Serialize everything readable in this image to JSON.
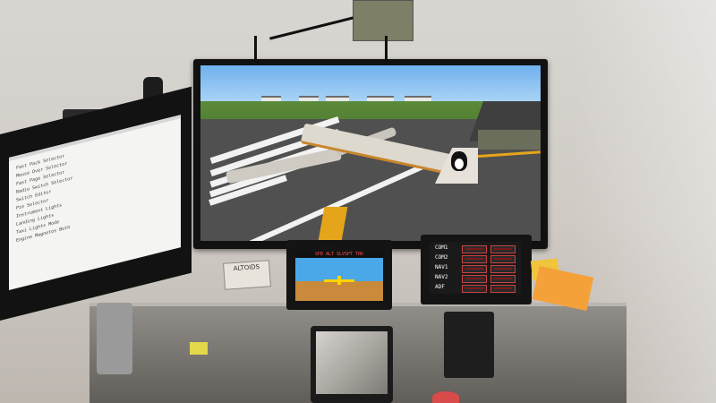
{
  "scene": {
    "left_monitor": {
      "lines": [
        "Fast Pack Selector",
        "Mouse Over Selector",
        "Fast Page Selector",
        "Radio Switch Selector",
        "Switch Editor",
        "Pie Selector",
        "Instrument Lights",
        "Landing Lights",
        "Taxi Lights Mode",
        "Engine Magnetos Both"
      ]
    },
    "pfd": {
      "header": "SPD ALT SLVSPT TRK"
    },
    "radio_panel": {
      "labels": [
        "COM1",
        "COM2",
        "NAV1",
        "NAV2",
        "ADF"
      ]
    },
    "altoids_label": "ALTOIDS",
    "colors": {
      "sky": "#6fb1ee",
      "grass": "#5b8a3a",
      "tarmac": "#505050",
      "taxi_line": "#e5a51b",
      "radio_border": "#c94141",
      "sticky_note": "#f4a13a"
    }
  }
}
